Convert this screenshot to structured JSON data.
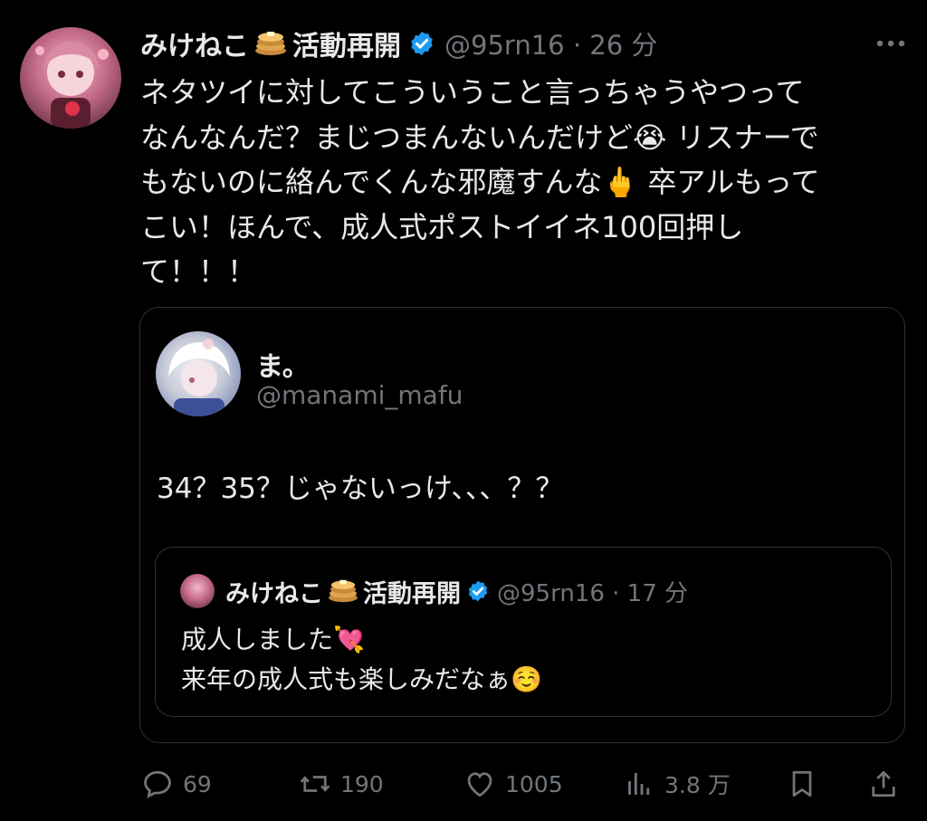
{
  "post": {
    "author_name": "みけねこ",
    "author_suffix": "活動再開",
    "handle_time": "@95rn16 · 26 分",
    "text": "ネタツイに対してこういうこと言っちゃうやつって\nなんなんだ？まじつまんないんだけど😭 リスナーで\nもないのに絡んでくんな邪魔すんな🖕 卒アルもって\nこい！ほんで、成人式ポストイイネ100回押し\nて！！！"
  },
  "quote": {
    "name": "ま。",
    "handle": "@manami_mafu",
    "text": "34？35？じゃないっけ、、、？？",
    "inner": {
      "author_name": "みけねこ",
      "author_suffix": "活動再開",
      "handle_time": "@95rn16 · 17 分",
      "line1": "成人しました💘",
      "line2": "来年の成人式も楽しみだなぁ☺️"
    }
  },
  "actions": {
    "reply_count": "69",
    "repost_count": "190",
    "like_count": "1005",
    "views_count": "3.8 万"
  },
  "colors": {
    "background": "#000000",
    "text": "#e7e9ea",
    "muted": "#71767b",
    "verified": "#1d9bf0",
    "border": "#2f3336"
  }
}
